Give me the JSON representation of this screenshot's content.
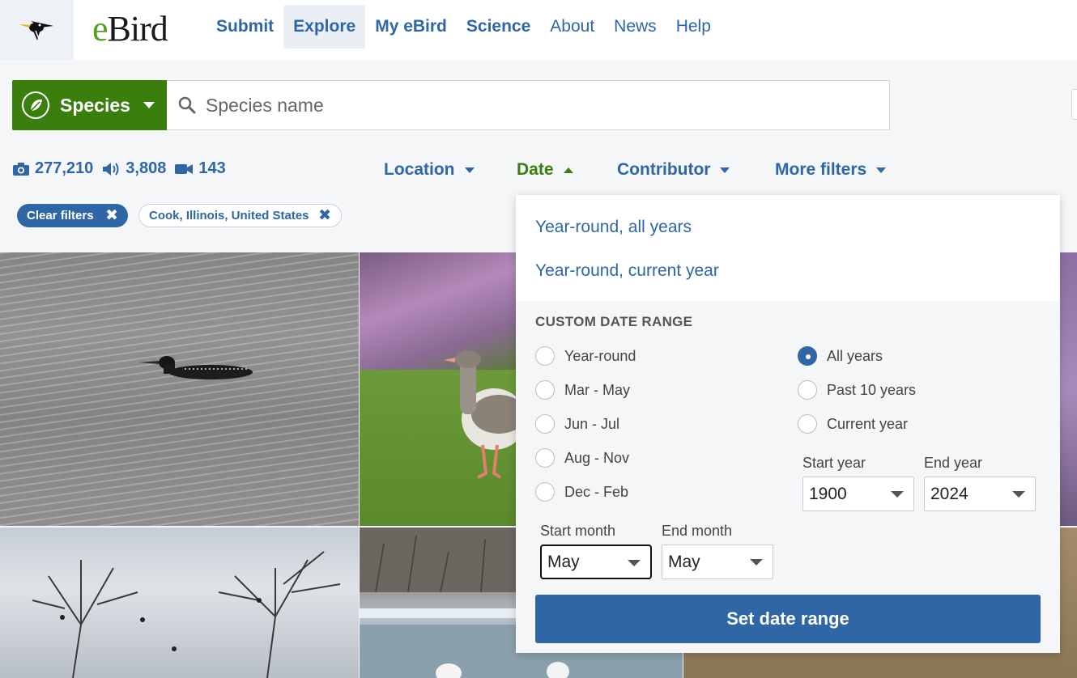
{
  "header": {
    "brand_e": "e",
    "brand_rest": "Bird",
    "nav": [
      {
        "label": "Submit"
      },
      {
        "label": "Explore"
      },
      {
        "label": "My eBird"
      },
      {
        "label": "Science"
      },
      {
        "label": "About"
      },
      {
        "label": "News"
      },
      {
        "label": "Help"
      }
    ]
  },
  "search": {
    "type_label": "Species",
    "placeholder": "Species name"
  },
  "counts": {
    "photos": "277,210",
    "audio": "3,808",
    "video": "143"
  },
  "filters": {
    "location": "Location",
    "date": "Date",
    "contributor": "Contributor",
    "more": "More filters"
  },
  "chips": {
    "clear": "Clear filters",
    "location": "Cook, Illinois, United States"
  },
  "date_panel": {
    "quick_options": [
      "Year-round, all years",
      "Year-round, current year"
    ],
    "custom_title": "CUSTOM DATE RANGE",
    "seasons": [
      "Year-round",
      "Mar - May",
      "Jun - Jul",
      "Aug - Nov",
      "Dec - Feb"
    ],
    "year_scopes": [
      "All years",
      "Past 10 years",
      "Current year"
    ],
    "selected_year_scope": "All years",
    "start_year_label": "Start year",
    "end_year_label": "End year",
    "start_year": "1900",
    "end_year": "2024",
    "start_month_label": "Start month",
    "end_month_label": "End month",
    "start_month": "May",
    "end_month": "May",
    "submit": "Set date range"
  },
  "colors": {
    "accent_blue": "#2f66a6",
    "brand_green": "#3a7f0d"
  }
}
